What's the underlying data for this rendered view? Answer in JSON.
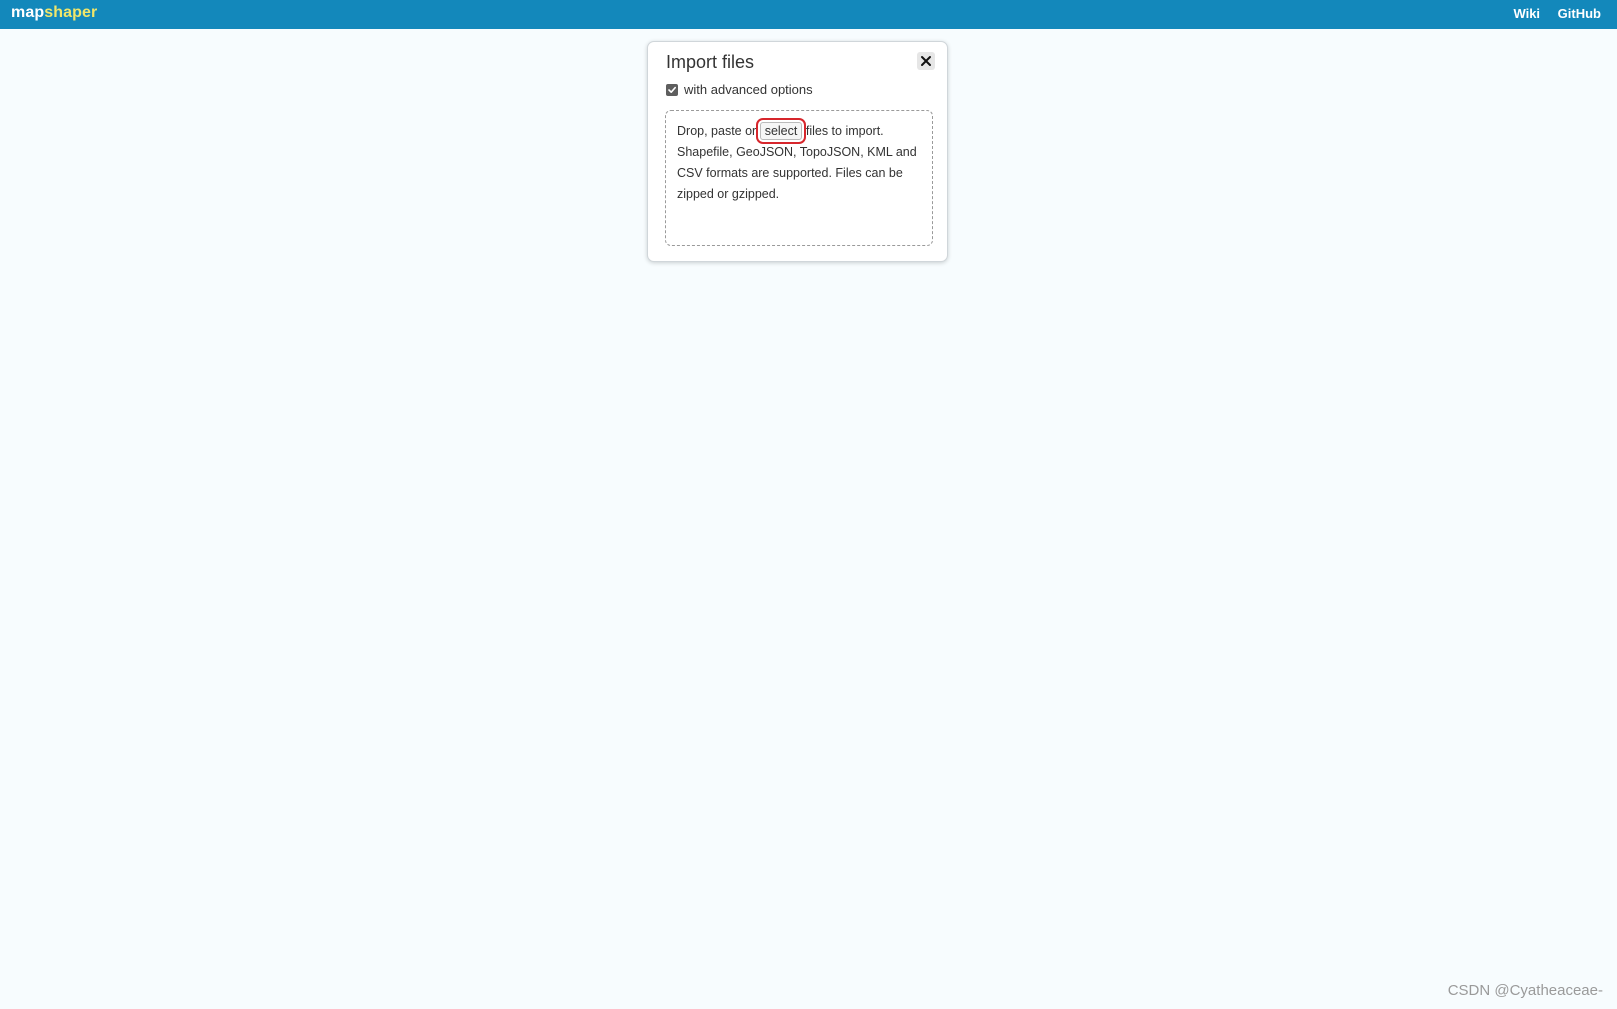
{
  "header": {
    "logo_part1": "map",
    "logo_part2": "shaper",
    "links": [
      "Wiki",
      "GitHub"
    ]
  },
  "dialog": {
    "title": "Import files",
    "close_icon": "close-icon",
    "advanced_label": "with advanced options",
    "advanced_checked": true,
    "drop_text_before": "Drop, paste or",
    "select_label": "select",
    "drop_text_after": "files to import. Shapefile, GeoJSON, TopoJSON, KML and CSV formats are supported. Files can be zipped or gzipped."
  },
  "watermark": "CSDN @Cyatheaceae-",
  "colors": {
    "topbar": "#1388bb",
    "logo_accent": "#f0e66a",
    "page_bg": "#f7fcfe",
    "highlight": "#d7262c"
  }
}
